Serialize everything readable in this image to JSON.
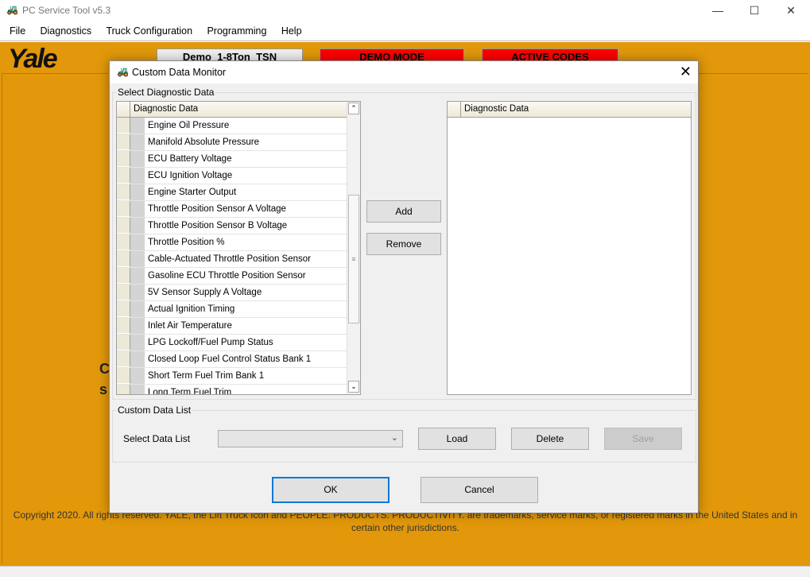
{
  "app": {
    "title": "PC Service Tool v5.3",
    "window_controls": [
      "minimize",
      "maximize",
      "close"
    ]
  },
  "menu": [
    "File",
    "Diagnostics",
    "Truck Configuration",
    "Programming",
    "Help"
  ],
  "header": {
    "logo": "Yale",
    "truck_button": "Demo_1-8Ton_TSN",
    "demo_mode": "DEMO MODE",
    "active_codes": "ACTIVE CODES",
    "demo_color": "#FF0000",
    "accent": "#E2980A"
  },
  "background": {
    "partial_text_1": "C",
    "partial_text_2": "s",
    "copyright": "Copyright 2020. All rights reserved. YALE, the Lift Truck Icon and PEOPLE. PRODUCTS. PRODUCTIVITY. are trademarks, service marks, or registered marks in the United States and in certain other jurisdictions."
  },
  "dialog": {
    "title": "Custom Data Monitor",
    "select_group": "Select Diagnostic Data",
    "left_grid": {
      "header": "Diagnostic Data",
      "rows": [
        "Engine Oil Pressure",
        "Manifold Absolute Pressure",
        "ECU Battery Voltage",
        "ECU Ignition Voltage",
        "Engine Starter Output",
        "Throttle Position Sensor A Voltage",
        "Throttle Position Sensor B Voltage",
        "Throttle Position %",
        "Cable-Actuated Throttle Position Sensor",
        "Gasoline ECU Throttle Position Sensor",
        "5V Sensor Supply A Voltage",
        "Actual Ignition Timing",
        "Inlet Air Temperature",
        "LPG Lockoff/Fuel Pump Status",
        "Closed Loop Fuel Control Status Bank 1",
        "Short Term Fuel Trim Bank 1",
        "Long Term Fuel Trim"
      ]
    },
    "right_grid": {
      "header": "Diagnostic Data",
      "rows": []
    },
    "add": "Add",
    "remove": "Remove",
    "custom_group": "Custom Data List",
    "select_list_label": "Select Data List",
    "select_list_value": "",
    "load": "Load",
    "delete": "Delete",
    "save": "Save",
    "ok": "OK",
    "cancel": "Cancel"
  }
}
